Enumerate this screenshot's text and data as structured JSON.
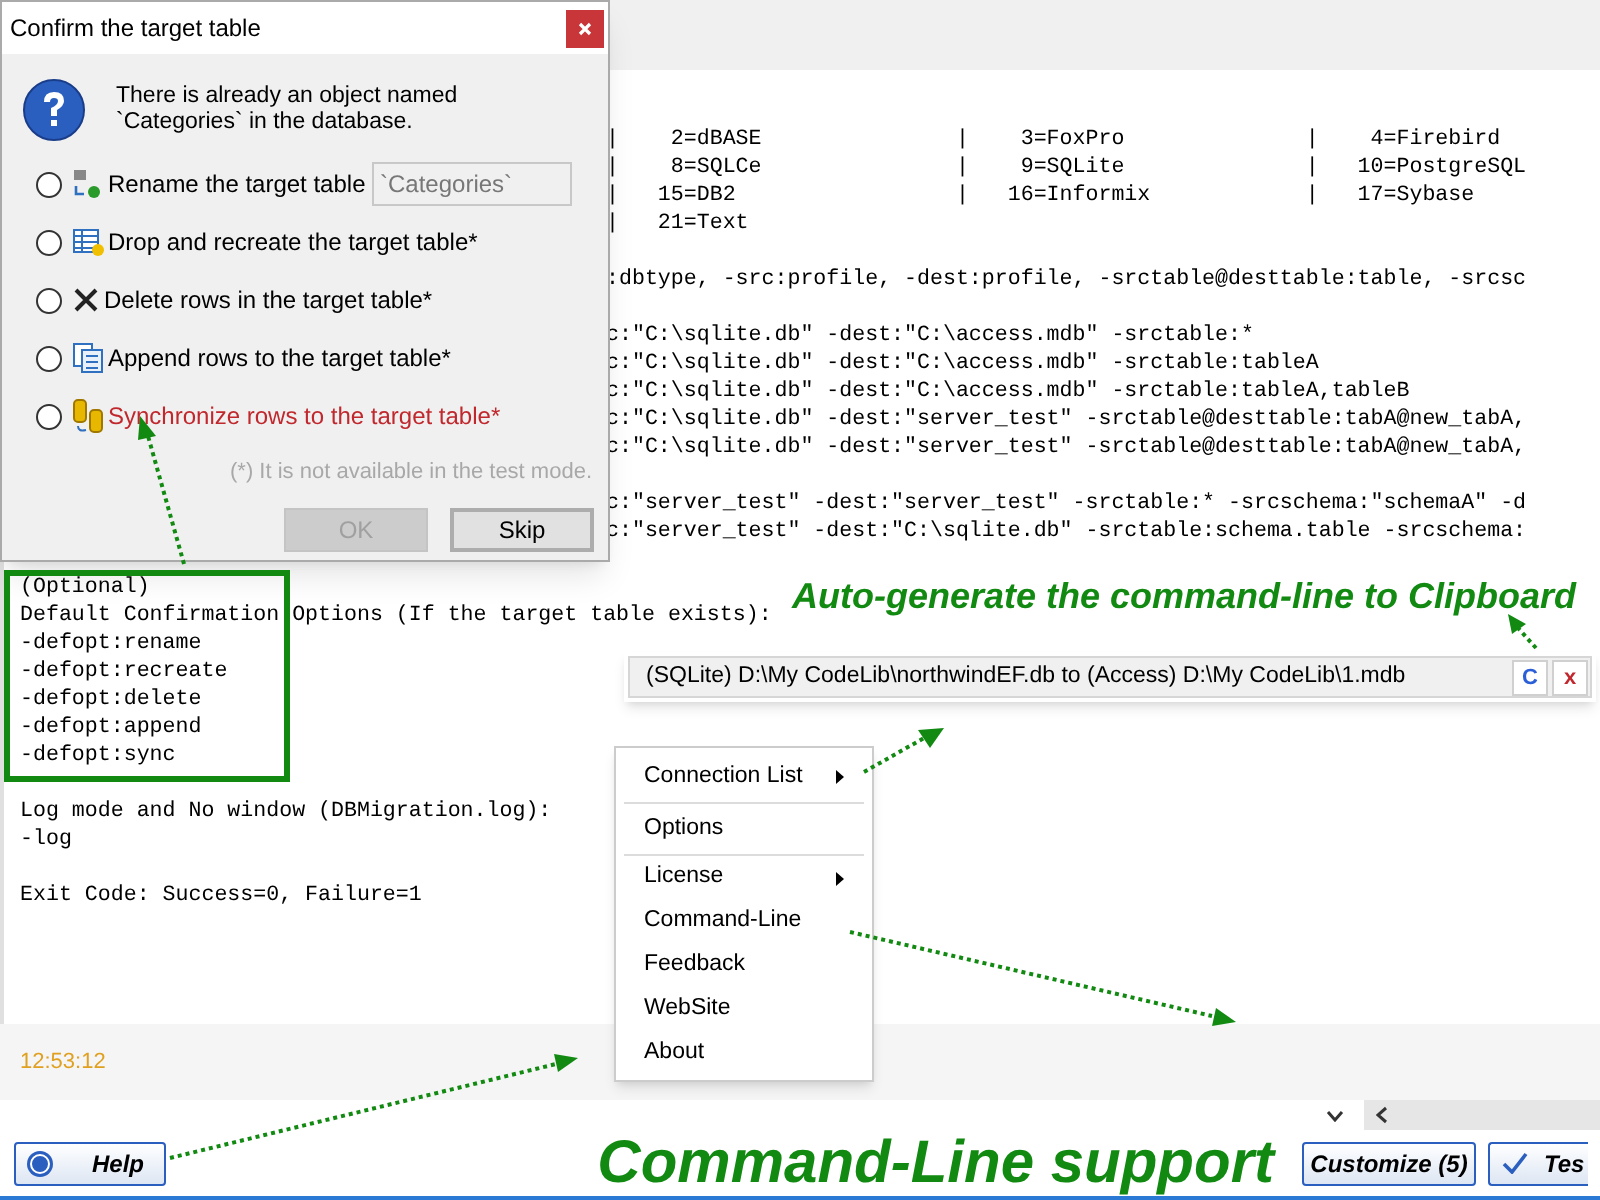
{
  "console": {
    "covered_blocks": [
      [
        "|    2=dBASE               |    3=FoxPro              |    4=Firebird",
        "|    8=SQLCe               |    9=SQLite              |   10=PostgreSQL",
        "|   15=DB2                 |   16=Informix            |   17=Sybase",
        "|   21=Text"
      ],
      [
        ":dbtype, -src:profile, -dest:profile, -srctable@desttable:table, -srcsc"
      ],
      [
        "c:\"C:\\sqlite.db\" -dest:\"C:\\access.mdb\" -srctable:*",
        "c:\"C:\\sqlite.db\" -dest:\"C:\\access.mdb\" -srctable:tableA",
        "c:\"C:\\sqlite.db\" -dest:\"C:\\access.mdb\" -srctable:tableA,tableB",
        "c:\"C:\\sqlite.db\" -dest:\"server_test\" -srctable@desttable:tabA@new_tabA,",
        "c:\"C:\\sqlite.db\" -dest:\"server_test\" -srctable@desttable:tabA@new_tabA,"
      ],
      [
        "c:\"server_test\" -dest:\"server_test\" -srctable:* -srcschema:\"schemaA\" -d",
        "c:\"server_test\" -dest:\"C:\\sqlite.db\" -srctable:schema.table -srcschema:"
      ]
    ],
    "blocks": [
      [
        "(Optional)",
        "Default Confirmation Options (If the target table exists):",
        "-defopt:rename",
        "-defopt:recreate",
        "-defopt:delete",
        "-defopt:append",
        "-defopt:sync"
      ],
      [
        "Log mode and No window (DBMigration.log):",
        "-log"
      ],
      [
        "Exit Code: Success=0, Failure=1"
      ]
    ]
  },
  "status_bar": {
    "time": "12:53:12"
  },
  "dialog": {
    "title": "Confirm the target table",
    "message": "There is already an object named `Categories` in the database.",
    "rename_field": {
      "placeholder": "`Categories`"
    },
    "options": [
      {
        "kind": "rename",
        "label": "Rename the target table",
        "selected": false,
        "highlighted": false
      },
      {
        "kind": "drop",
        "label": "Drop and recreate the target table*",
        "selected": false,
        "highlighted": false
      },
      {
        "kind": "delete",
        "label": "Delete rows in the target table*",
        "selected": false,
        "highlighted": false
      },
      {
        "kind": "append",
        "label": "Append rows to the target table*",
        "selected": false,
        "highlighted": false
      },
      {
        "kind": "sync",
        "label": "Synchronize rows to the target table*",
        "selected": false,
        "highlighted": true
      }
    ],
    "note": "(*) It is not available in the test mode.",
    "buttons": [
      {
        "label": "OK",
        "disabled": true,
        "default": false
      },
      {
        "label": "Skip",
        "disabled": false,
        "default": true
      }
    ]
  },
  "clipboard_caption": "Auto-generate the command-line to Clipboard",
  "clipboard_bar": {
    "text": "(SQLite) D:\\My CodeLib\\northwindEF.db to (Access) D:\\My CodeLib\\1.mdb",
    "buttons": [
      {
        "kind": "copy",
        "label": "C"
      },
      {
        "kind": "close",
        "label": "x"
      }
    ]
  },
  "menu": {
    "items": [
      {
        "label": "Connection List",
        "submenu": true,
        "separator_after": true
      },
      {
        "label": "Options",
        "submenu": false,
        "separator_after": true
      },
      {
        "label": "License",
        "submenu": true,
        "separator_after": false
      },
      {
        "label": "Command-Line",
        "submenu": false,
        "separator_after": false
      },
      {
        "label": "Feedback",
        "submenu": false,
        "separator_after": false
      },
      {
        "label": "WebSite",
        "submenu": false,
        "separator_after": false
      },
      {
        "label": "About",
        "submenu": false,
        "separator_after": false
      }
    ]
  },
  "footer": {
    "help_button": "Help",
    "caption": "Command-Line support",
    "buttons": [
      {
        "kind": "plain",
        "label": "Customize (5)"
      },
      {
        "kind": "check",
        "label": "Tes"
      }
    ]
  }
}
